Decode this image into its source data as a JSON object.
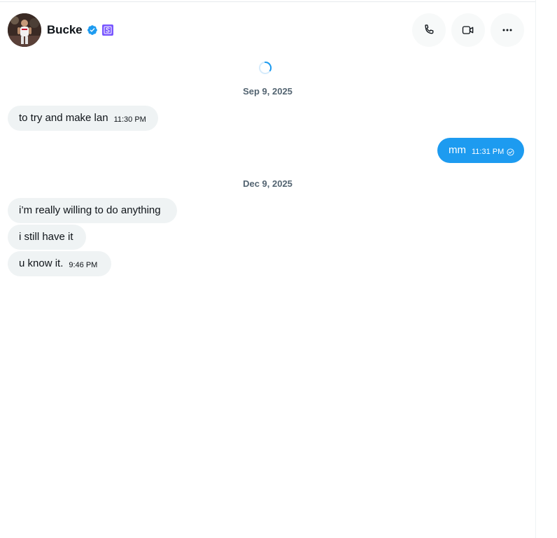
{
  "header": {
    "name": "Bucke",
    "verified_badge": "verified-check-icon",
    "sub_badge": "subscription-s-icon",
    "actions": [
      "phone-icon",
      "video-icon",
      "more-icon"
    ]
  },
  "colors": {
    "accent": "#1d9bf0",
    "incoming_bubble": "#eff3f4",
    "sub_badge": "#7856ff",
    "muted_text": "#536471"
  },
  "conversation": {
    "date_1": "Sep 9, 2025",
    "date_2": "Dec 9, 2025",
    "messages": [
      {
        "direction": "in",
        "text": "to try and make lan",
        "time": "11:30 PM"
      },
      {
        "direction": "out",
        "text": "mm",
        "time": "11:31 PM",
        "status": "seen-check-icon"
      },
      {
        "direction": "in",
        "text": "i’m really willing to do anything"
      },
      {
        "direction": "in",
        "text": "i still have it"
      },
      {
        "direction": "in",
        "text": "u know it.",
        "time": "9:46 PM"
      }
    ]
  }
}
